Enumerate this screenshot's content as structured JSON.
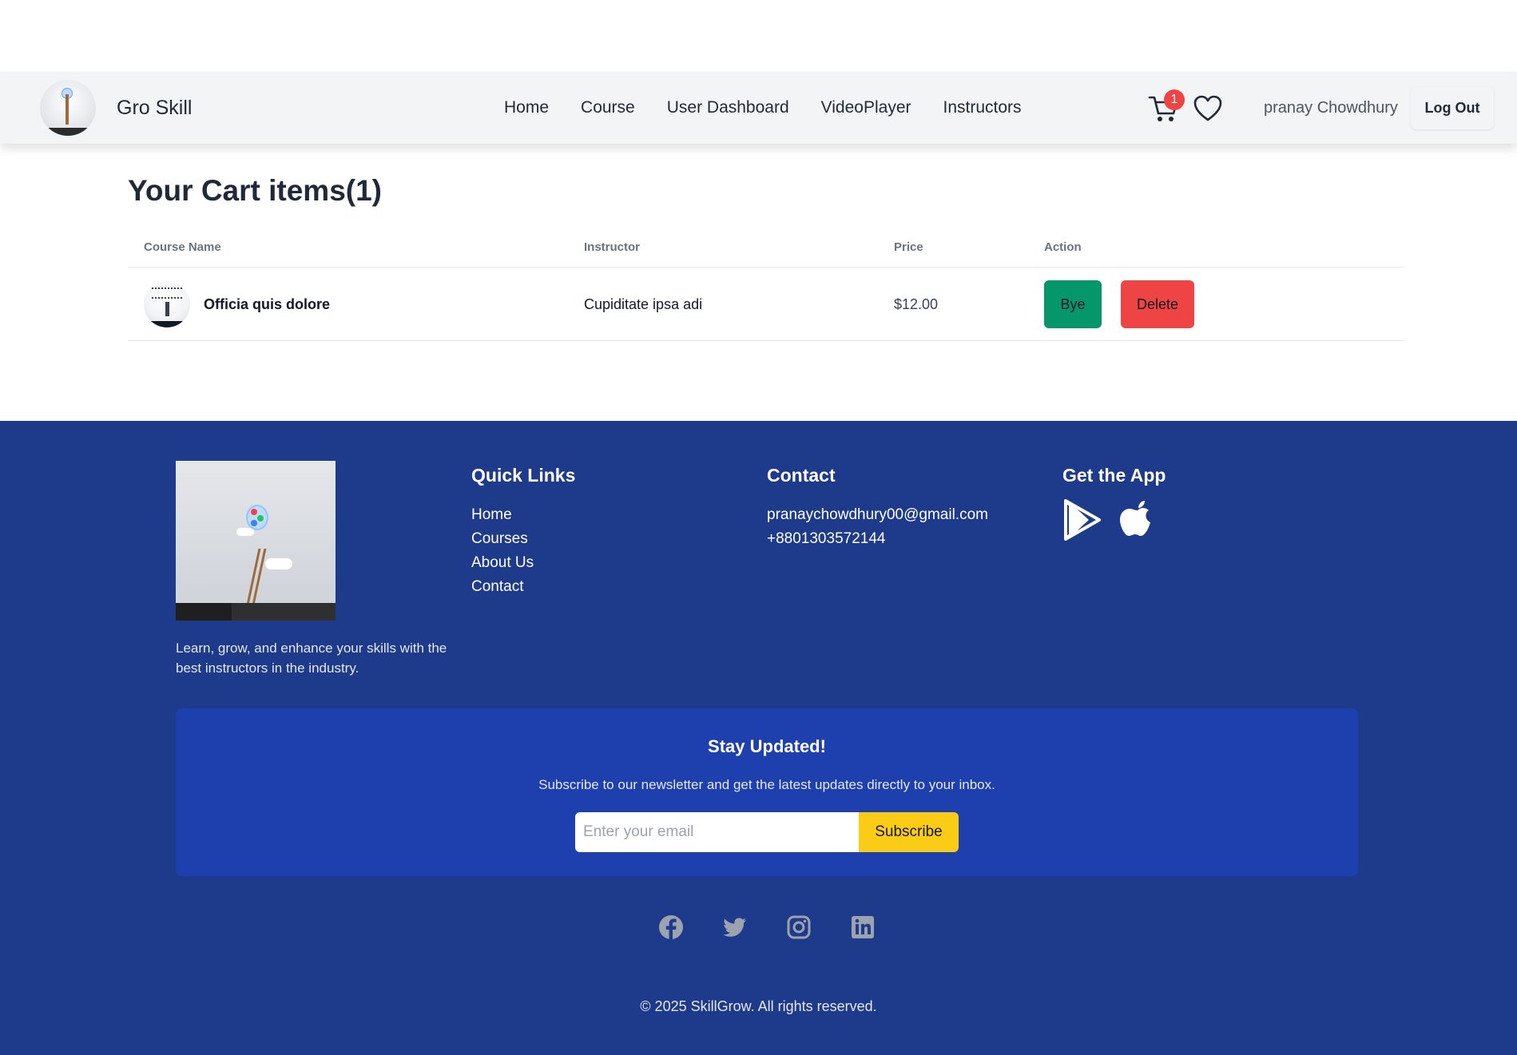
{
  "brand": {
    "name": "Gro Skill",
    "logo_icon": "lightbulb-ladder-logo"
  },
  "nav": {
    "links": [
      "Home",
      "Course",
      "User Dashboard",
      "VideoPlayer",
      "Instructors"
    ],
    "cart_count": "1",
    "user_name": "pranay Chowdhury",
    "logout_label": "Log Out"
  },
  "cart": {
    "title": "Your Cart items(1)",
    "columns": [
      "Course Name",
      "Instructor",
      "Price",
      "Action"
    ],
    "rows": [
      {
        "course_name": "Officia quis dolore",
        "instructor": "Cupiditate ipsa adi",
        "price": "$12.00",
        "bye_label": "Bye",
        "delete_label": "Delete"
      }
    ]
  },
  "footer": {
    "description": "Learn, grow, and enhance your skills with the best instructors in the industry.",
    "quick_links": {
      "title": "Quick Links",
      "items": [
        "Home",
        "Courses",
        "About Us",
        "Contact"
      ]
    },
    "contact": {
      "title": "Contact",
      "email": "pranaychowdhury00@gmail.com",
      "phone": "+8801303572144"
    },
    "app": {
      "title": "Get the App",
      "icons": [
        "google-play-icon",
        "apple-icon"
      ]
    },
    "newsletter": {
      "title": "Stay Updated!",
      "subtitle": "Subscribe to our newsletter and get the latest updates directly to your inbox.",
      "placeholder": "Enter your email",
      "button_label": "Subscribe"
    },
    "social_icons": [
      "facebook-icon",
      "twitter-icon",
      "instagram-icon",
      "linkedin-icon"
    ],
    "copyright": "© 2025 SkillGrow. All rights reserved."
  },
  "colors": {
    "navbar_bg": "#f3f4f6",
    "footer_bg": "#1e3a8a",
    "newsletter_bg": "#1e40af",
    "bye_button": "#059669",
    "delete_button": "#ef4444",
    "subscribe_button": "#facc15",
    "badge": "#ef4444"
  }
}
